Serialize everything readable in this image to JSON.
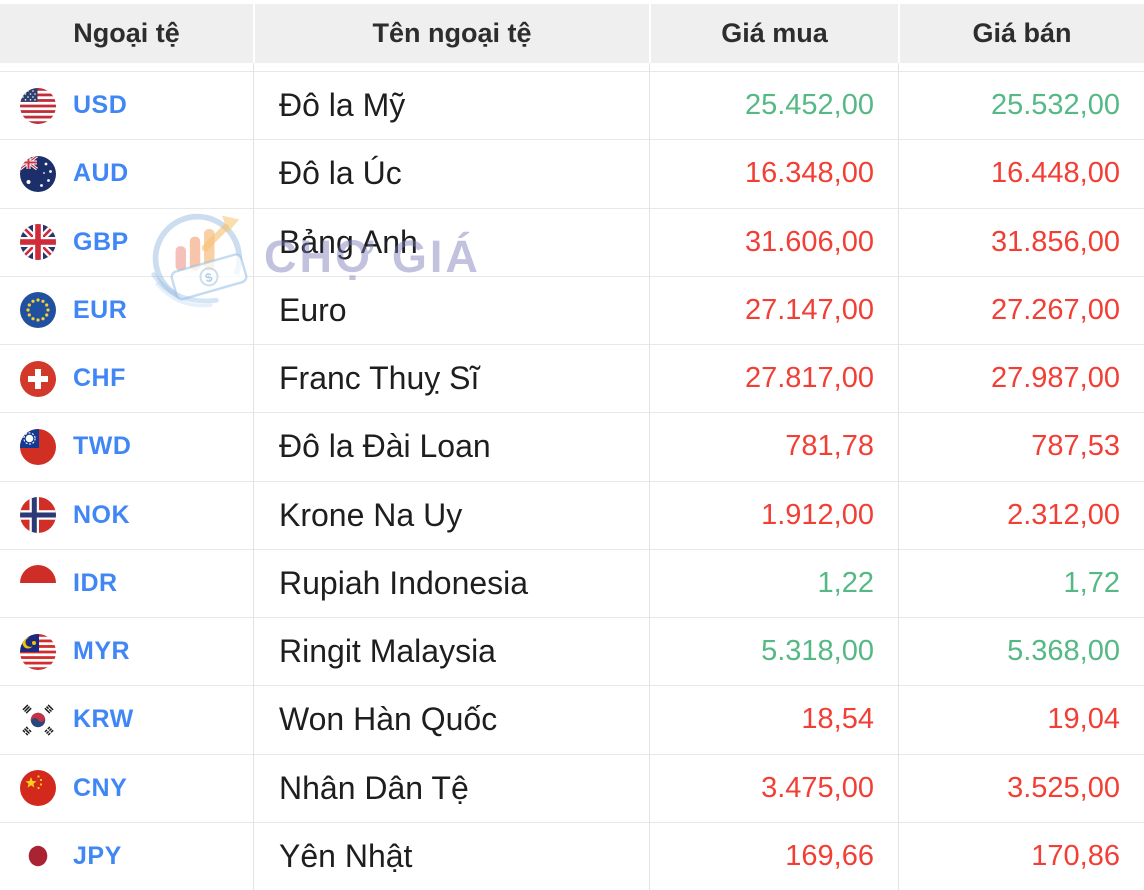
{
  "header": {
    "currency": "Ngoại tệ",
    "name": "Tên ngoại tệ",
    "buy": "Giá mua",
    "sell": "Giá bán"
  },
  "watermark": {
    "text": "CHỢ GIÁ",
    "logo_icon": "cho-gia-logo-icon"
  },
  "colors": {
    "price_up": "#55b885",
    "price_down": "#f23f36",
    "code_link": "#4087f5",
    "header_bg": "#efefef"
  },
  "rows": [
    {
      "code": "USD",
      "flag_icon": "flag-us-icon",
      "name": "Đô la Mỹ",
      "buy": "25.452,00",
      "sell": "25.532,00",
      "trend": "up"
    },
    {
      "code": "AUD",
      "flag_icon": "flag-au-icon",
      "name": "Đô la Úc",
      "buy": "16.348,00",
      "sell": "16.448,00",
      "trend": "down"
    },
    {
      "code": "GBP",
      "flag_icon": "flag-gb-icon",
      "name": "Bảng Anh",
      "buy": "31.606,00",
      "sell": "31.856,00",
      "trend": "down"
    },
    {
      "code": "EUR",
      "flag_icon": "flag-eu-icon",
      "name": "Euro",
      "buy": "27.147,00",
      "sell": "27.267,00",
      "trend": "down"
    },
    {
      "code": "CHF",
      "flag_icon": "flag-ch-icon",
      "name": "Franc Thuỵ Sĩ",
      "buy": "27.817,00",
      "sell": "27.987,00",
      "trend": "down"
    },
    {
      "code": "TWD",
      "flag_icon": "flag-tw-icon",
      "name": "Đô la Đài Loan",
      "buy": "781,78",
      "sell": "787,53",
      "trend": "down"
    },
    {
      "code": "NOK",
      "flag_icon": "flag-no-icon",
      "name": "Krone Na Uy",
      "buy": "1.912,00",
      "sell": "2.312,00",
      "trend": "down"
    },
    {
      "code": "IDR",
      "flag_icon": "flag-id-icon",
      "name": "Rupiah Indonesia",
      "buy": "1,22",
      "sell": "1,72",
      "trend": "up"
    },
    {
      "code": "MYR",
      "flag_icon": "flag-my-icon",
      "name": "Ringit Malaysia",
      "buy": "5.318,00",
      "sell": "5.368,00",
      "trend": "up"
    },
    {
      "code": "KRW",
      "flag_icon": "flag-kr-icon",
      "name": "Won Hàn Quốc",
      "buy": "18,54",
      "sell": "19,04",
      "trend": "down"
    },
    {
      "code": "CNY",
      "flag_icon": "flag-cn-icon",
      "name": "Nhân Dân Tệ",
      "buy": "3.475,00",
      "sell": "3.525,00",
      "trend": "down"
    },
    {
      "code": "JPY",
      "flag_icon": "flag-jp-icon",
      "name": "Yên Nhật",
      "buy": "169,66",
      "sell": "170,86",
      "trend": "down"
    }
  ]
}
